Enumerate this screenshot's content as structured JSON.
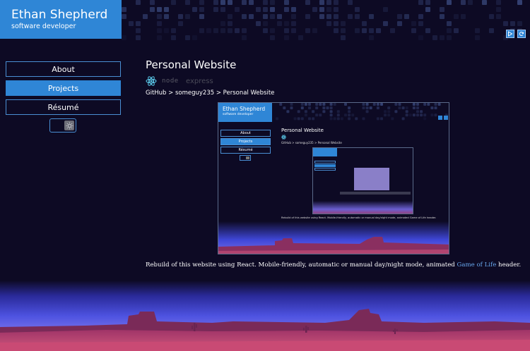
{
  "site": {
    "name": "Ethan Shepherd",
    "tagline": "software developer"
  },
  "header_buttons": [
    {
      "icon": "play-icon"
    },
    {
      "icon": "refresh-icon"
    }
  ],
  "nav": {
    "items": [
      {
        "label": "About",
        "active": false
      },
      {
        "label": "Projects",
        "active": true
      },
      {
        "label": "Résumé",
        "active": false
      }
    ]
  },
  "theme_toggle": {
    "icon": "sun-icon"
  },
  "project": {
    "title": "Personal Website",
    "tech": [
      {
        "name": "react",
        "icon": "react-icon"
      },
      {
        "name": "node",
        "label": "node"
      },
      {
        "name": "express",
        "label": "express"
      }
    ],
    "breadcrumb": "GitHub > someguy235 > Personal Website",
    "description_prefix": "Rebuild of this website using React. Mobile-friendly, automatic or manual day/night mode, animated ",
    "description_link": "Game of Life",
    "description_suffix": " header."
  },
  "colors": {
    "background": "#0d0a24",
    "accent": "#2f86d6",
    "link": "#68a8ee"
  }
}
